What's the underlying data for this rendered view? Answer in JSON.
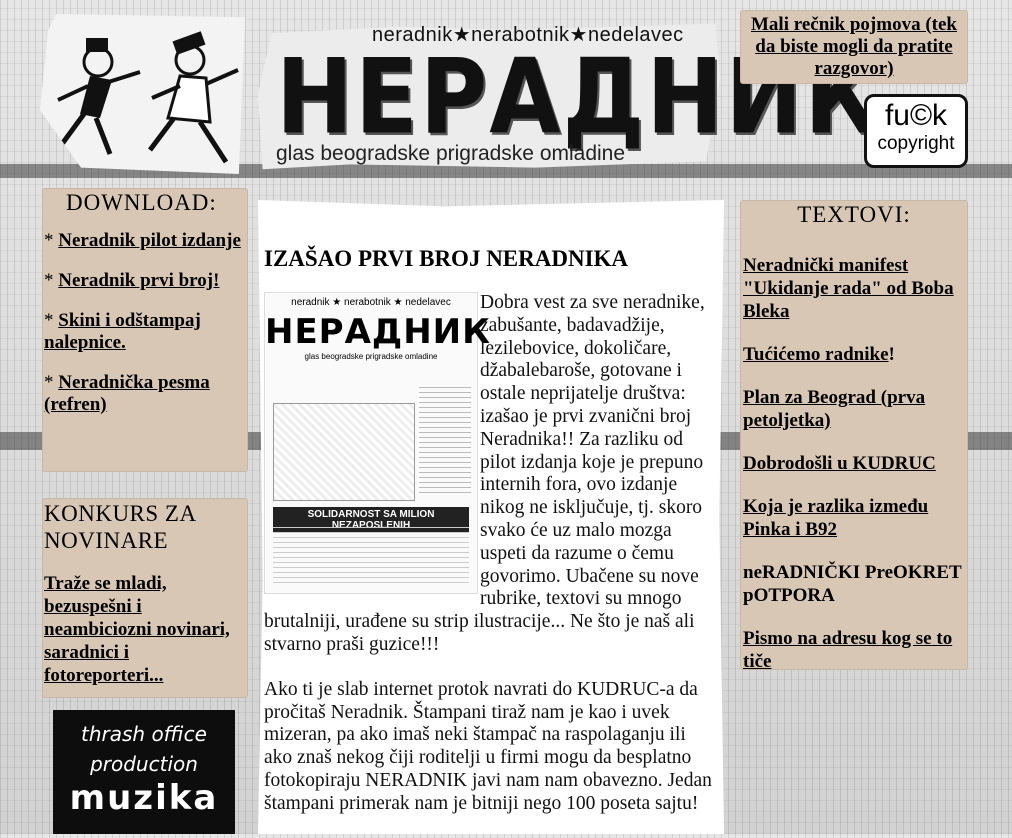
{
  "header": {
    "tagline_top": "neradnik★nerabotnik★nedelavec",
    "logo_text": "НЕРАДНИК",
    "tagline_bottom": "glas beogradske prigradske omladine"
  },
  "download": {
    "title": "DOWNLOAD:",
    "items": [
      {
        "prefix": "* ",
        "label": "Neradnik pilot izdanje"
      },
      {
        "prefix": "* ",
        "label": "Neradnik prvi broj!"
      },
      {
        "prefix": "* ",
        "label": "Skini i odštampaj nalepnice."
      },
      {
        "prefix": "* ",
        "label": "Neradnička pesma (refren)"
      }
    ]
  },
  "konkurs": {
    "title": "KONKURS ZA NOVINARE",
    "link": "Traže se mladi, bezuspešni i neambiciozni novinari, saradnici i fotoreporteri..."
  },
  "thrash": {
    "line1": "thrash office",
    "line2": "production",
    "line3": "muzika"
  },
  "main": {
    "headline": "IZAŠAO PRVI BROJ NERADNIKA",
    "cover": {
      "tagline": "neradnik ★ nerabotnik ★ nedelavec",
      "logo": "НЕРАДНИК",
      "subtitle": "glas beogradske prigradske omladine",
      "headline": "SOLIDARNOST SA MILION NEZAPOSLENIH"
    },
    "paragraph1": "Dobra vest za sve neradnike, zabušante, badavadžije, lezilebovice, dokoličare, džabalebaroše, gotovane i ostale neprijatelje društva: izašao je prvi zvanični broj Neradnika!! Za razliku od pilot izdanja koje je prepuno internih fora, ovo izdanje nikog ne isključuje, tj. skoro svako će uz malo mozga uspeti da razume o čemu govorimo. Ubačene su nove rubrike, textovi su mnogo brutalniji, urađene su strip ilustracije... Ne što je naš ali stvarno praši guzice!!!",
    "paragraph2": "Ako ti je slab internet protok navrati do KUDRUC-a da pročitaš Neradnik. Štampani tiraž nam je kao i uvek mizeran, pa ako imaš neki štampač na raspolaganju ili ako znaš nekog čiji roditelji u firmi mogu da besplatno fotokopiraju NERADNIK javi nam nam obavezno. Jedan štampani primerak nam je bitniji nego 100 poseta sajtu!"
  },
  "recnik": {
    "link": "Mali rečnik pojmova (tek da biste mogli da pratite razgovor)"
  },
  "badge": {
    "line1": "fu©k",
    "line2": "copyright"
  },
  "textovi": {
    "title": "TEXTOVI:",
    "items": [
      {
        "label": "Neradnički manifest \"Ukidanje rada\" od Boba Bleka",
        "suffix": ""
      },
      {
        "label": "Tućićemo radnike",
        "suffix": "!"
      },
      {
        "label": "Plan za Beograd (prva petoljetka)",
        "suffix": ""
      },
      {
        "label": "Dobrodošli u KUDRUC",
        "suffix": ""
      },
      {
        "label": "Koja je razlika između Pinka i B92",
        "suffix": ""
      },
      {
        "label": "neRADNIČKI PreOKRET pOTPORA",
        "suffix": ""
      },
      {
        "label": "Pismo na adresu kog se to tiče",
        "suffix": ""
      }
    ]
  },
  "colors": {
    "paper": "#d8c7b5",
    "ink": "#000000",
    "background": "#d8d8d8"
  }
}
